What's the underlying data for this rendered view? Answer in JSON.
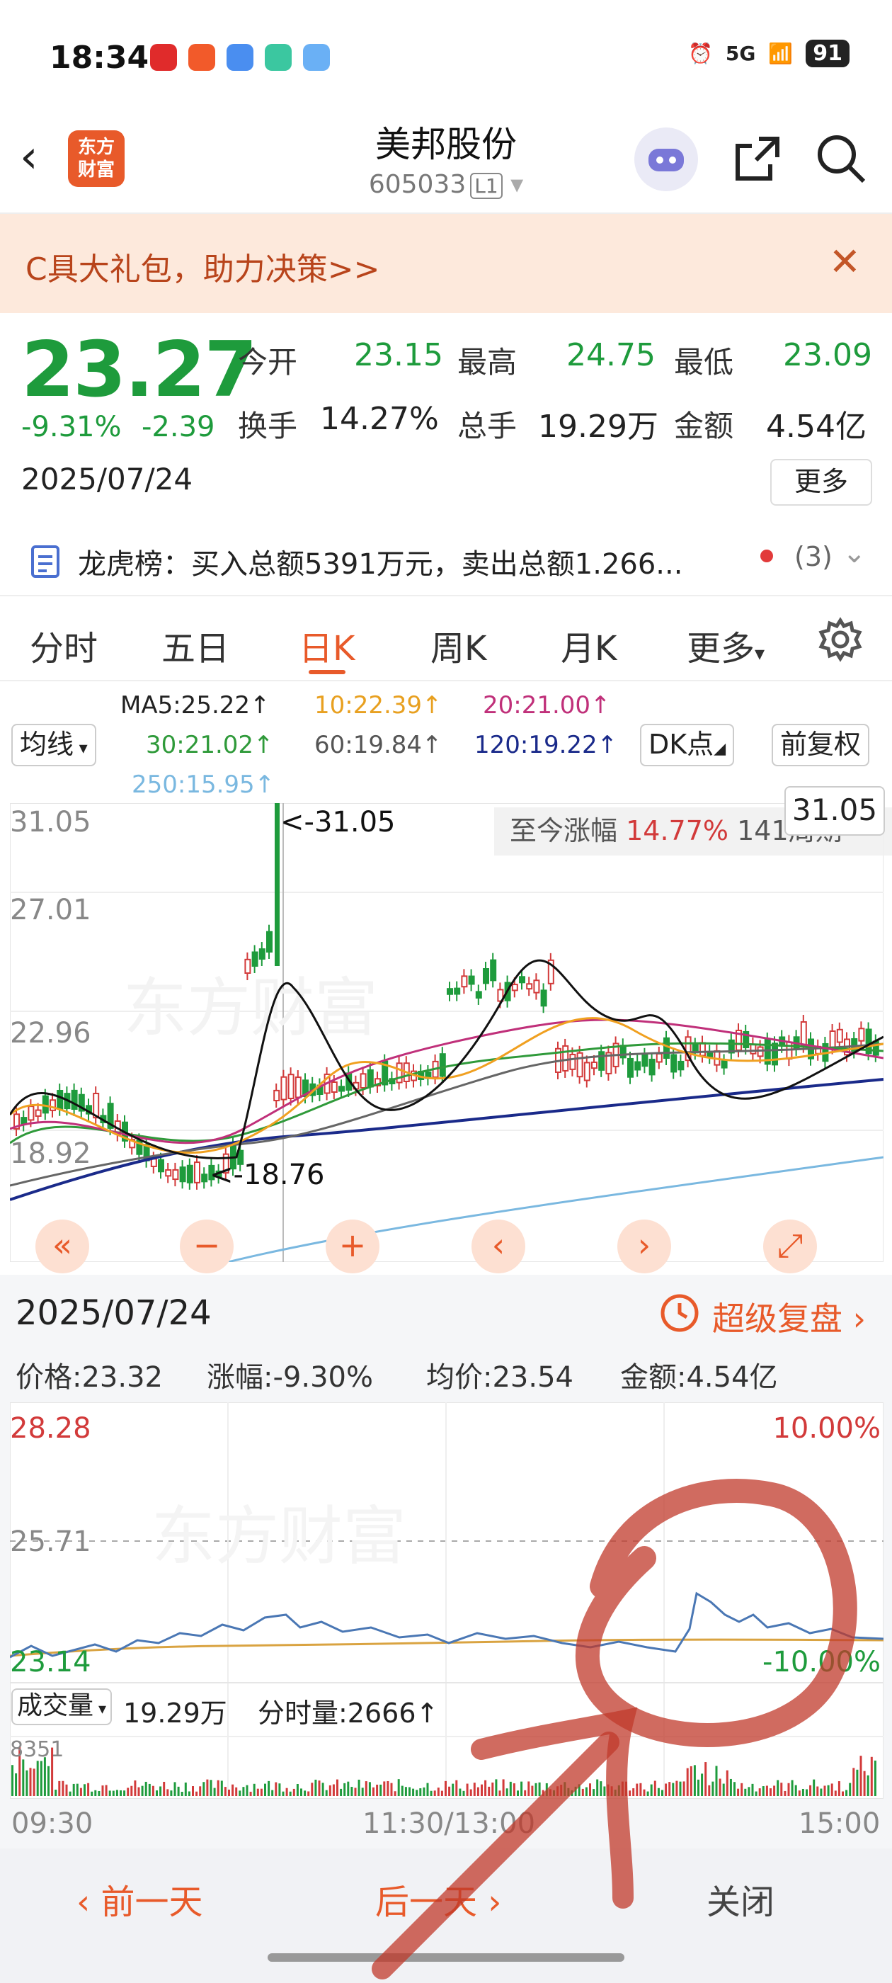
{
  "status_bar": {
    "time": "18:34",
    "network": "5G",
    "battery": "91"
  },
  "header": {
    "app_logo": "东方\n财富",
    "title": "美邦股份",
    "code": "605033",
    "level": "L1"
  },
  "banner": {
    "text": "C具大礼包，助力决策>>"
  },
  "quote": {
    "price": "23.27",
    "change_pct": "-9.31%",
    "change": "-2.39",
    "date": "2025/07/24",
    "open_label": "今开",
    "open": "23.15",
    "high_label": "最高",
    "high": "24.75",
    "low_label": "最低",
    "low": "23.09",
    "turnover_label": "换手",
    "turnover": "14.27%",
    "volume_label": "总手",
    "volume": "19.29万",
    "amount_label": "金额",
    "amount": "4.54亿",
    "more": "更多"
  },
  "lhb": {
    "text": "龙虎榜：买入总额5391万元，卖出总额1.266...",
    "count": "(3)"
  },
  "tabs": [
    "分时",
    "五日",
    "日K",
    "周K",
    "月K",
    "更多"
  ],
  "ma": {
    "selector": "均线",
    "ma5": "MA5:25.22↑",
    "ma10": "10:22.39↑",
    "ma20": "20:21.00↑",
    "ma30": "30:21.02↑",
    "ma60": "60:19.84↑",
    "ma120": "120:19.22↑",
    "ma250": "250:15.95↑",
    "dk": "DK点",
    "adjust": "前复权"
  },
  "kline": {
    "y_labels": [
      "31.05",
      "27.01",
      "22.96",
      "18.92"
    ],
    "high_marker": "<-31.05",
    "low_marker": "<-18.76",
    "range_label": "至今涨幅",
    "range_value": "14.77%",
    "range_period": "141周期",
    "price_tag": "31.05",
    "colors": {
      "ma5": "#111111",
      "ma10": "#f0a020",
      "ma20": "#c0307a",
      "ma30": "#2f9a3a",
      "ma60": "#666666",
      "ma120": "#1a2a8a",
      "ma250": "#7ab8e0"
    }
  },
  "detail": {
    "date": "2025/07/24",
    "replay": "超级复盘",
    "price": "价格:23.32",
    "change": "涨幅:-9.30%",
    "avg": "均价:23.54",
    "amount": "金额:4.54亿"
  },
  "intraday": {
    "y_top": "28.28",
    "y_mid": "25.71",
    "y_bot": "23.14",
    "pct_top": "10.00%",
    "pct_bot": "-10.00%",
    "vol_selector": "成交量",
    "vol_total": "19.29万",
    "vol_tick": "分时量:2666↑",
    "vol_max": "8351",
    "times": [
      "09:30",
      "11:30/13:00",
      "15:00"
    ]
  },
  "bottom": {
    "prev": "前一天",
    "next": "后一天",
    "close": "关闭"
  }
}
